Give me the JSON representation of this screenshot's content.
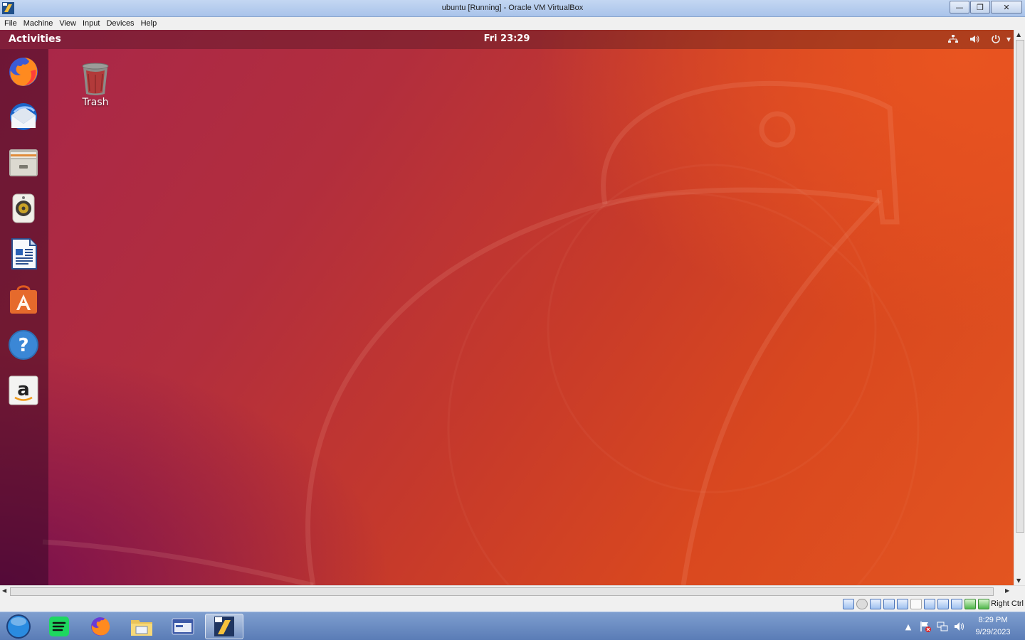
{
  "window": {
    "title": "ubuntu [Running] - Oracle VM VirtualBox",
    "buttons": [
      "minimize",
      "maximize",
      "close"
    ]
  },
  "menubar": {
    "items": [
      "File",
      "Machine",
      "View",
      "Input",
      "Devices",
      "Help"
    ]
  },
  "gnome": {
    "activities": "Activities",
    "clock": "Fri 23:29",
    "tray_icons": [
      "network-icon",
      "volume-icon",
      "power-icon",
      "dropdown-arrow-icon"
    ]
  },
  "dock": {
    "items": [
      "Firefox Web Browser",
      "Thunderbird Mail",
      "Files",
      "Rhythmbox",
      "LibreOffice Writer",
      "Ubuntu Software",
      "Help",
      "Amazon"
    ]
  },
  "desktop": {
    "icons": [
      {
        "label": "Trash",
        "icon": "trash-icon"
      }
    ]
  },
  "statusbar": {
    "host_key": "Right Ctrl"
  },
  "taskbar": {
    "pinned": [
      "start-orb",
      "spotify-icon",
      "firefox-icon",
      "file-explorer-icon",
      "virtualbox-manager-icon",
      "virtualbox-vm-icon"
    ],
    "tray_time": "8:29 PM",
    "tray_date": "9/29/2023"
  },
  "colors": {
    "ubuntu_orange": "#E95420",
    "aubergine": "#77216F",
    "taskbar_blue": "#5A7CB6"
  }
}
